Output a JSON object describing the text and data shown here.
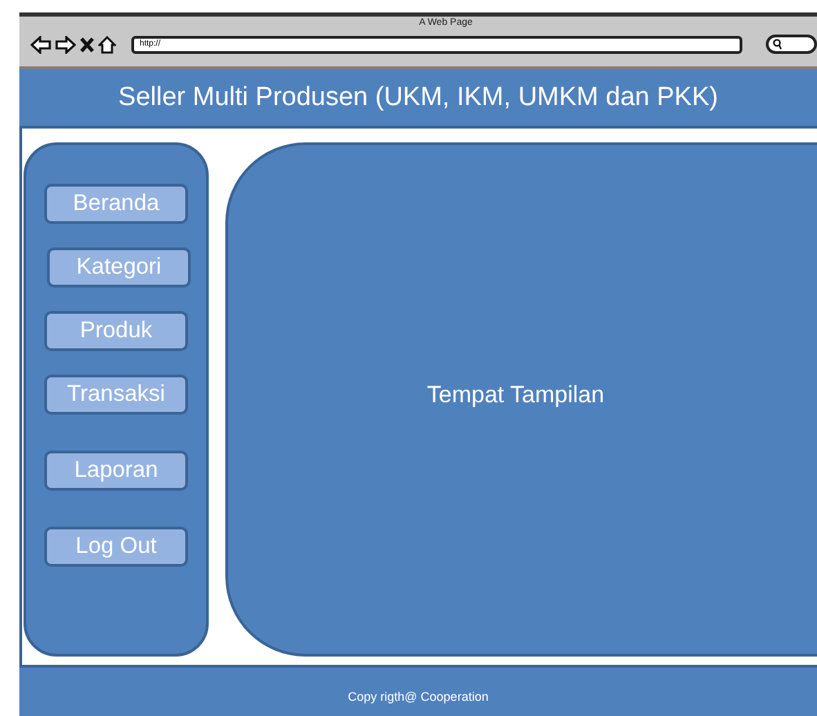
{
  "browser": {
    "title": "A Web Page",
    "url": "http://"
  },
  "header": {
    "title": "Seller Multi Produsen (UKM, IKM, UMKM dan PKK)"
  },
  "menu": [
    {
      "label": "Beranda"
    },
    {
      "label": "Kategori"
    },
    {
      "label": "Produk"
    },
    {
      "label": "Transaksi"
    },
    {
      "label": "Laporan"
    },
    {
      "label": "Log Out"
    }
  ],
  "content": {
    "label": "Tempat Tampilan"
  },
  "footer": {
    "text": "Copy rigth@ Cooperation"
  }
}
